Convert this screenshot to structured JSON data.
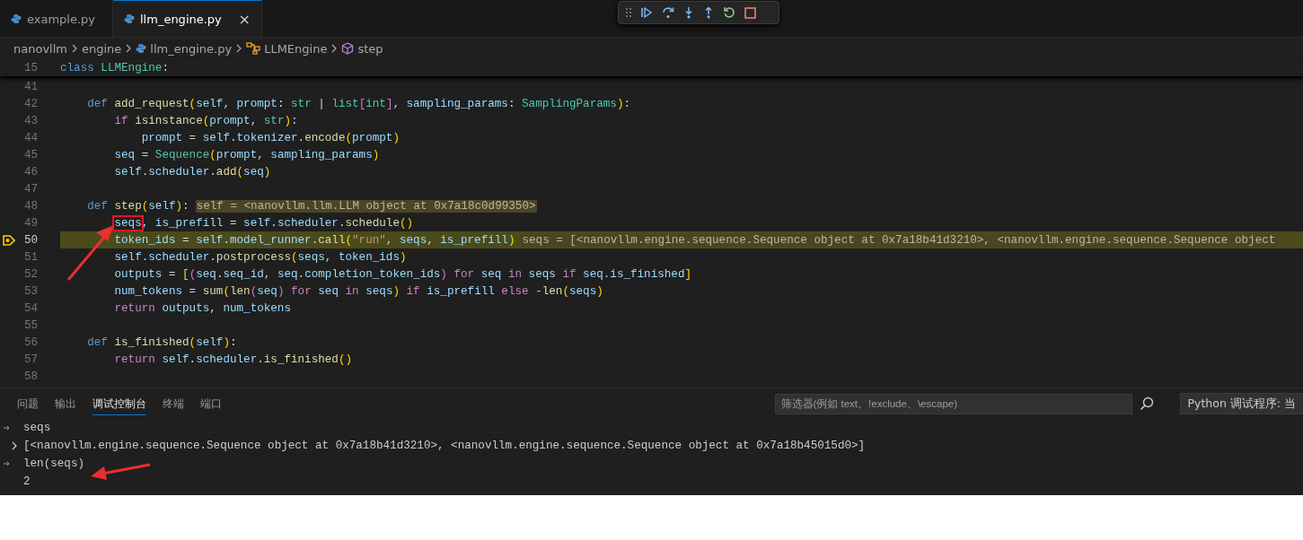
{
  "editor_tabs": [
    {
      "label": "example.py",
      "selected": false
    },
    {
      "label": "llm_engine.py",
      "selected": true,
      "close": "×"
    }
  ],
  "debug_toolbar": [
    {
      "kind": "continue"
    },
    {
      "kind": "step-over"
    },
    {
      "kind": "step-into"
    },
    {
      "kind": "step-out"
    },
    {
      "kind": "restart"
    },
    {
      "kind": "stop"
    }
  ],
  "breadcrumb": [
    {
      "label": "nanovllm",
      "kind": "folder"
    },
    {
      "label": "engine",
      "kind": "folder"
    },
    {
      "label": "llm_engine.py",
      "kind": "file"
    },
    {
      "label": "LLMEngine",
      "kind": "class"
    },
    {
      "label": "step",
      "kind": "method"
    }
  ],
  "sticky_line": {
    "number": "15",
    "tokens": [
      {
        "text": "class ",
        "kind": "kw"
      },
      {
        "text": "LLMEngine",
        "kind": "cls"
      },
      {
        "text": ":",
        "kind": "p"
      }
    ]
  },
  "lines": [
    {
      "number": "41",
      "current": false
    },
    {
      "number": "42",
      "current": false,
      "tokens": [
        {
          "text": "    def ",
          "kind": "kw"
        },
        {
          "text": "add_request",
          "kind": "fn"
        },
        {
          "text": "(",
          "kind": "b1"
        },
        {
          "text": "self",
          "kind": "var"
        },
        {
          "text": ", ",
          "kind": "p"
        },
        {
          "text": "prompt",
          "kind": "var"
        },
        {
          "text": ": ",
          "kind": "p"
        },
        {
          "text": "str",
          "kind": "cls"
        },
        {
          "text": " | ",
          "kind": "p"
        },
        {
          "text": "list",
          "kind": "cls"
        },
        {
          "text": "[",
          "kind": "b2"
        },
        {
          "text": "int",
          "kind": "cls"
        },
        {
          "text": "]",
          "kind": "b2"
        },
        {
          "text": ", ",
          "kind": "p"
        },
        {
          "text": "sampling_params",
          "kind": "var"
        },
        {
          "text": ": ",
          "kind": "p"
        },
        {
          "text": "SamplingParams",
          "kind": "cls"
        },
        {
          "text": ")",
          "kind": "b1"
        },
        {
          "text": ":",
          "kind": "p"
        }
      ]
    },
    {
      "number": "43",
      "current": false,
      "tokens": [
        {
          "text": "        if ",
          "kind": "ctl"
        },
        {
          "text": "isinstance",
          "kind": "fn"
        },
        {
          "text": "(",
          "kind": "b1"
        },
        {
          "text": "prompt",
          "kind": "var"
        },
        {
          "text": ", ",
          "kind": "p"
        },
        {
          "text": "str",
          "kind": "cls"
        },
        {
          "text": ")",
          "kind": "b1"
        },
        {
          "text": ":",
          "kind": "p"
        }
      ]
    },
    {
      "number": "44",
      "current": false,
      "tokens": [
        {
          "text": "            prompt",
          "kind": "var"
        },
        {
          "text": " = ",
          "kind": "p"
        },
        {
          "text": "self",
          "kind": "var"
        },
        {
          "text": ".",
          "kind": "p"
        },
        {
          "text": "tokenizer",
          "kind": "var"
        },
        {
          "text": ".",
          "kind": "p"
        },
        {
          "text": "encode",
          "kind": "fn"
        },
        {
          "text": "(",
          "kind": "b1"
        },
        {
          "text": "prompt",
          "kind": "var"
        },
        {
          "text": ")",
          "kind": "b1"
        }
      ]
    },
    {
      "number": "45",
      "current": false,
      "tokens": [
        {
          "text": "        seq",
          "kind": "var"
        },
        {
          "text": " = ",
          "kind": "p"
        },
        {
          "text": "Sequence",
          "kind": "cls"
        },
        {
          "text": "(",
          "kind": "b1"
        },
        {
          "text": "prompt",
          "kind": "var"
        },
        {
          "text": ", ",
          "kind": "p"
        },
        {
          "text": "sampling_params",
          "kind": "var"
        },
        {
          "text": ")",
          "kind": "b1"
        }
      ]
    },
    {
      "number": "46",
      "current": false,
      "tokens": [
        {
          "text": "        self",
          "kind": "var"
        },
        {
          "text": ".",
          "kind": "p"
        },
        {
          "text": "scheduler",
          "kind": "var"
        },
        {
          "text": ".",
          "kind": "p"
        },
        {
          "text": "add",
          "kind": "fn"
        },
        {
          "text": "(",
          "kind": "b1"
        },
        {
          "text": "seq",
          "kind": "var"
        },
        {
          "text": ")",
          "kind": "b1"
        }
      ]
    },
    {
      "number": "47",
      "current": false
    },
    {
      "number": "48",
      "current": false,
      "tokens": [
        {
          "text": "    def ",
          "kind": "kw"
        },
        {
          "text": "step",
          "kind": "fn"
        },
        {
          "text": "(",
          "kind": "b1"
        },
        {
          "text": "self",
          "kind": "var"
        },
        {
          "text": ")",
          "kind": "b1"
        },
        {
          "text": ":",
          "kind": "p"
        }
      ],
      "inline_value": "self = <nanovllm.llm.LLM object at 0x7a18c0d99350>"
    },
    {
      "number": "49",
      "current": false,
      "tokens": [
        {
          "text": "        seqs",
          "kind": "box"
        },
        {
          "text": ", ",
          "kind": "p"
        },
        {
          "text": "is_prefill",
          "kind": "var"
        },
        {
          "text": " = ",
          "kind": "p"
        },
        {
          "text": "self",
          "kind": "var"
        },
        {
          "text": ".",
          "kind": "p"
        },
        {
          "text": "scheduler",
          "kind": "var"
        },
        {
          "text": ".",
          "kind": "p"
        },
        {
          "text": "schedule",
          "kind": "fn"
        },
        {
          "text": "()",
          "kind": "b1"
        }
      ]
    },
    {
      "number": "50",
      "current": true,
      "tokens": [
        {
          "text": "        token_ids",
          "kind": "var"
        },
        {
          "text": " = ",
          "kind": "p"
        },
        {
          "text": "self",
          "kind": "var"
        },
        {
          "text": ".",
          "kind": "p"
        },
        {
          "text": "model_runner",
          "kind": "var"
        },
        {
          "text": ".",
          "kind": "p"
        },
        {
          "text": "call",
          "kind": "fn"
        },
        {
          "text": "(",
          "kind": "b1"
        },
        {
          "text": "\"run\"",
          "kind": "str"
        },
        {
          "text": ", ",
          "kind": "p"
        },
        {
          "text": "seqs",
          "kind": "var"
        },
        {
          "text": ", ",
          "kind": "p"
        },
        {
          "text": "is_prefill",
          "kind": "var"
        },
        {
          "text": ")",
          "kind": "b1"
        }
      ],
      "inline_value": "seqs = [<nanovllm.engine.sequence.Sequence object at 0x7a18b41d3210>, <nanovllm.engine.sequence.Sequence object"
    },
    {
      "number": "51",
      "current": false,
      "tokens": [
        {
          "text": "        self",
          "kind": "var"
        },
        {
          "text": ".",
          "kind": "p"
        },
        {
          "text": "scheduler",
          "kind": "var"
        },
        {
          "text": ".",
          "kind": "p"
        },
        {
          "text": "postprocess",
          "kind": "fn"
        },
        {
          "text": "(",
          "kind": "b1"
        },
        {
          "text": "seqs",
          "kind": "var"
        },
        {
          "text": ", ",
          "kind": "p"
        },
        {
          "text": "token_ids",
          "kind": "var"
        },
        {
          "text": ")",
          "kind": "b1"
        }
      ]
    },
    {
      "number": "52",
      "current": false,
      "tokens": [
        {
          "text": "        outputs",
          "kind": "var"
        },
        {
          "text": " = ",
          "kind": "p"
        },
        {
          "text": "[",
          "kind": "b1"
        },
        {
          "text": "(",
          "kind": "b2"
        },
        {
          "text": "seq",
          "kind": "var"
        },
        {
          "text": ".",
          "kind": "p"
        },
        {
          "text": "seq_id",
          "kind": "var"
        },
        {
          "text": ", ",
          "kind": "p"
        },
        {
          "text": "seq",
          "kind": "var"
        },
        {
          "text": ".",
          "kind": "p"
        },
        {
          "text": "completion_token_ids",
          "kind": "var"
        },
        {
          "text": ")",
          "kind": "b2"
        },
        {
          "text": " for ",
          "kind": "ctl"
        },
        {
          "text": "seq",
          "kind": "var"
        },
        {
          "text": " in ",
          "kind": "ctl"
        },
        {
          "text": "seqs",
          "kind": "var"
        },
        {
          "text": " if ",
          "kind": "ctl"
        },
        {
          "text": "seq",
          "kind": "var"
        },
        {
          "text": ".",
          "kind": "p"
        },
        {
          "text": "is_finished",
          "kind": "var"
        },
        {
          "text": "]",
          "kind": "b1"
        }
      ]
    },
    {
      "number": "53",
      "current": false,
      "tokens": [
        {
          "text": "        num_tokens",
          "kind": "var"
        },
        {
          "text": " = ",
          "kind": "p"
        },
        {
          "text": "sum",
          "kind": "fn"
        },
        {
          "text": "(",
          "kind": "b1"
        },
        {
          "text": "len",
          "kind": "fn"
        },
        {
          "text": "(",
          "kind": "b2"
        },
        {
          "text": "seq",
          "kind": "var"
        },
        {
          "text": ")",
          "kind": "b2"
        },
        {
          "text": " for ",
          "kind": "ctl"
        },
        {
          "text": "seq",
          "kind": "var"
        },
        {
          "text": " in ",
          "kind": "ctl"
        },
        {
          "text": "seqs",
          "kind": "var"
        },
        {
          "text": ")",
          "kind": "b1"
        },
        {
          "text": " if ",
          "kind": "ctl"
        },
        {
          "text": "is_prefill",
          "kind": "var"
        },
        {
          "text": " else ",
          "kind": "ctl"
        },
        {
          "text": "-",
          "kind": "p"
        },
        {
          "text": "len",
          "kind": "fn"
        },
        {
          "text": "(",
          "kind": "b1"
        },
        {
          "text": "seqs",
          "kind": "var"
        },
        {
          "text": ")",
          "kind": "b1"
        }
      ]
    },
    {
      "number": "54",
      "current": false,
      "tokens": [
        {
          "text": "        return ",
          "kind": "ctl"
        },
        {
          "text": "outputs",
          "kind": "var"
        },
        {
          "text": ", ",
          "kind": "p"
        },
        {
          "text": "num_tokens",
          "kind": "var"
        }
      ]
    },
    {
      "number": "55",
      "current": false
    },
    {
      "number": "56",
      "current": false,
      "tokens": [
        {
          "text": "    def ",
          "kind": "kw"
        },
        {
          "text": "is_finished",
          "kind": "fn"
        },
        {
          "text": "(",
          "kind": "b1"
        },
        {
          "text": "self",
          "kind": "var"
        },
        {
          "text": ")",
          "kind": "b1"
        },
        {
          "text": ":",
          "kind": "p"
        }
      ]
    },
    {
      "number": "57",
      "current": false,
      "tokens": [
        {
          "text": "        return ",
          "kind": "ctl"
        },
        {
          "text": "self",
          "kind": "var"
        },
        {
          "text": ".",
          "kind": "p"
        },
        {
          "text": "scheduler",
          "kind": "var"
        },
        {
          "text": ".",
          "kind": "p"
        },
        {
          "text": "is_finished",
          "kind": "fn"
        },
        {
          "text": "()",
          "kind": "b1"
        }
      ]
    },
    {
      "number": "58",
      "current": false
    }
  ],
  "panel": {
    "tabs": [
      {
        "label": "问题",
        "selected": false
      },
      {
        "label": "输出",
        "selected": false
      },
      {
        "label": "调试控制台",
        "selected": true
      },
      {
        "label": "终端",
        "selected": false
      },
      {
        "label": "端口",
        "selected": false
      }
    ],
    "filter": {
      "placeholder": "筛选器(例如 text、!exclude、\\escape)"
    },
    "session": "Python 调试程序: 当",
    "console": [
      {
        "kind": "input",
        "text": "seqs"
      },
      {
        "kind": "result",
        "text": "[<nanovllm.engine.sequence.Sequence object at 0x7a18b41d3210>, <nanovllm.engine.sequence.Sequence object at 0x7a18b45015d0>]"
      },
      {
        "kind": "input",
        "text": "len(seqs)"
      },
      {
        "kind": "value",
        "text": "2"
      }
    ]
  }
}
